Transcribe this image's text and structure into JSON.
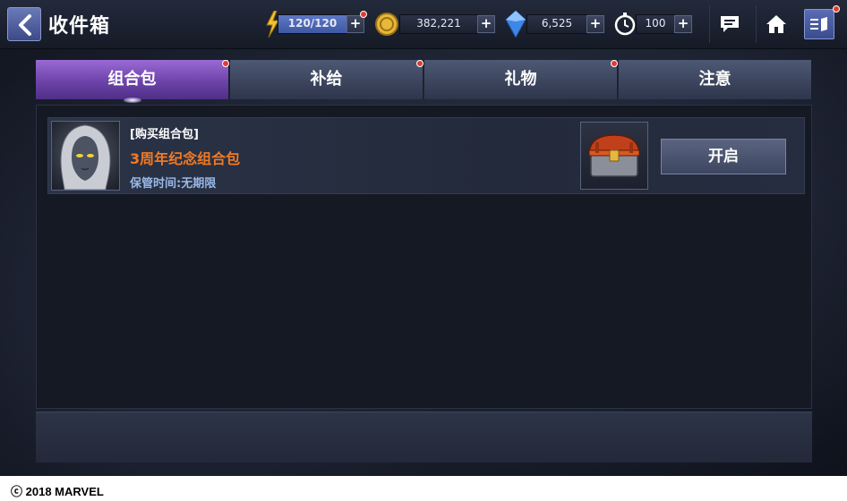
{
  "header": {
    "title": "收件箱",
    "energy": "120/120",
    "gold": "382,221",
    "crystals": "6,525",
    "timer_count": "100",
    "plus_label": "+"
  },
  "tabs": [
    {
      "label": "组合包",
      "active": true,
      "notification": true
    },
    {
      "label": "补给",
      "active": false,
      "notification": true
    },
    {
      "label": "礼物",
      "active": false,
      "notification": true
    },
    {
      "label": "注意",
      "active": false,
      "notification": false
    }
  ],
  "inbox": {
    "items": [
      {
        "category": "[购买组合包]",
        "name": "3周年纪念组合包",
        "expiry": "保管时间:无期限",
        "button_label": "开启"
      }
    ]
  },
  "footer": {
    "copyright": "2018 MARVEL"
  },
  "colors": {
    "active_tab": "#7a4cc0",
    "item_name": "#f07a24",
    "notification_dot": "#e23b2e"
  }
}
